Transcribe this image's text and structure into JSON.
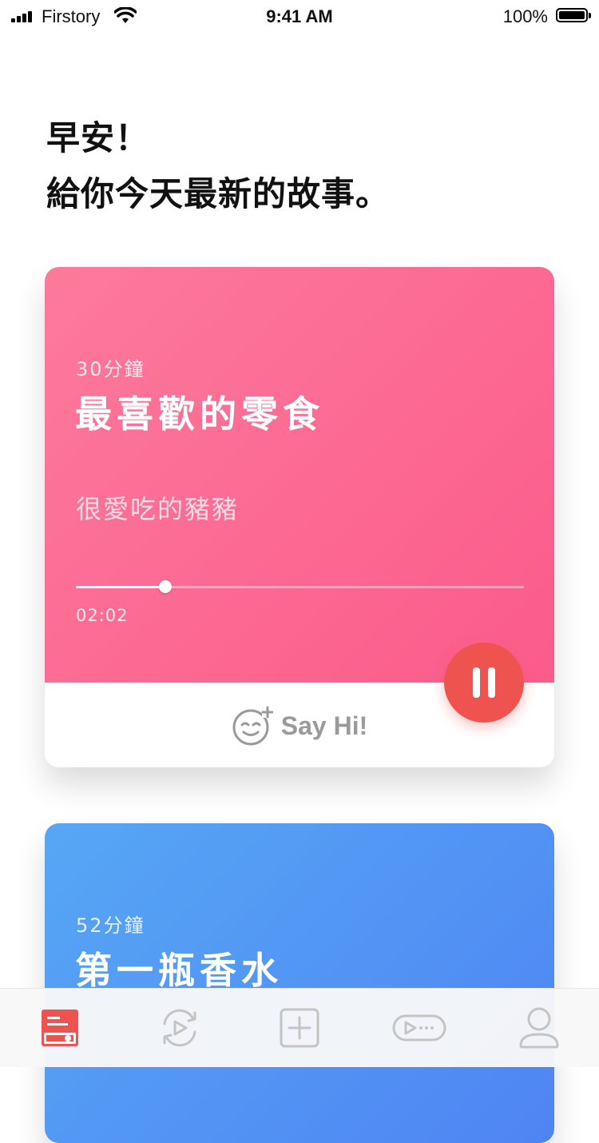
{
  "status_bar": {
    "carrier": "Firstory",
    "time": "9:41 AM",
    "battery": "100%"
  },
  "greeting": {
    "line1": "早安！",
    "line2": "給你今天最新的故事。"
  },
  "cards": [
    {
      "duration": "30分鐘",
      "title": "最喜歡的零食",
      "subtitle": "很愛吃的豬豬",
      "elapsed": "02:02",
      "progress": 0.2,
      "say_hi_label": "Say Hi!",
      "colors": {
        "gradient_start": "#fd7a9b",
        "gradient_end": "#fb5b8b"
      }
    },
    {
      "duration": "52分鐘",
      "title": "第一瓶香水",
      "colors": {
        "gradient_start": "#56a7f5",
        "gradient_end": "#4f84f3"
      }
    }
  ],
  "tab_bar": {
    "items": [
      {
        "icon": "stories-icon",
        "active": true
      },
      {
        "icon": "replay-icon",
        "active": false
      },
      {
        "icon": "add-icon",
        "active": false
      },
      {
        "icon": "video-icon",
        "active": false
      },
      {
        "icon": "profile-icon",
        "active": false
      }
    ]
  },
  "colors": {
    "accent": "#ef5350",
    "tab_inactive": "#c4c4c4"
  }
}
